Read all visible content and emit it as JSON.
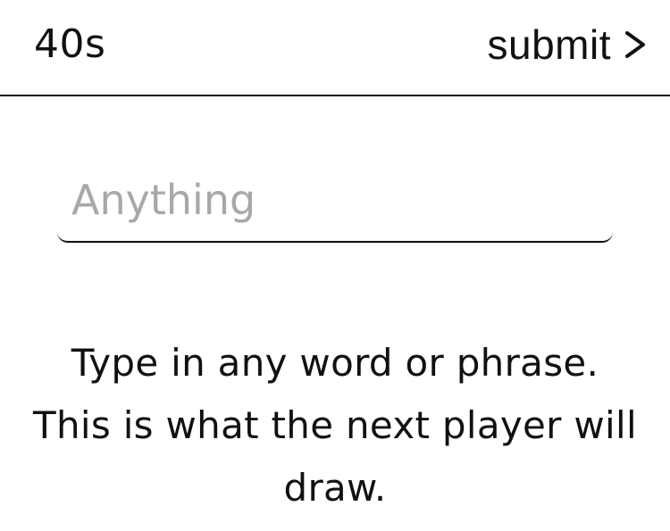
{
  "header": {
    "timer": "40s",
    "submit_label": "submit",
    "submit_icon": "chevron-right-icon"
  },
  "prompt": {
    "input_placeholder": "Anything",
    "input_value": ""
  },
  "instructions": {
    "text": "Type in any word or phrase. This is what the next player will draw."
  },
  "colors": {
    "background": "#ffffff",
    "text": "#111111",
    "placeholder": "#a8a8a8",
    "divider": "#111111"
  }
}
